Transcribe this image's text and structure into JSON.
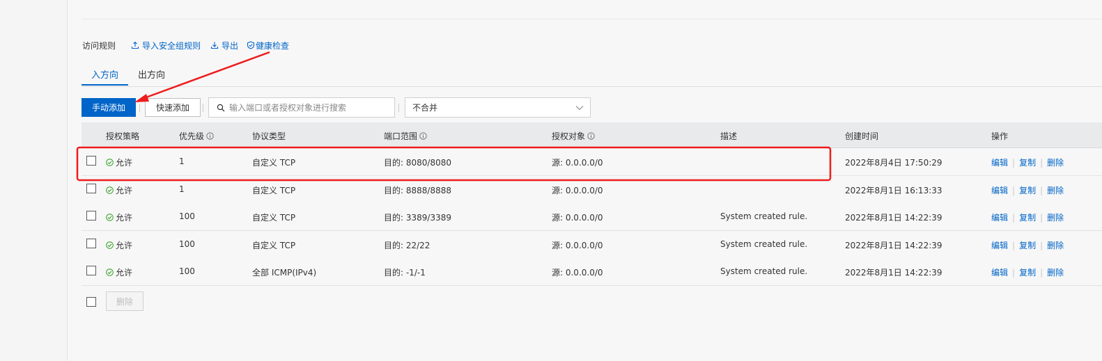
{
  "section": {
    "title": "访问规则",
    "links": {
      "import": "导入安全组规则",
      "export": "导出",
      "health": "健康检查"
    }
  },
  "tabs": [
    "入方向",
    "出方向"
  ],
  "toolbar": {
    "manual_add": "手动添加",
    "quick_add": "快速添加",
    "search_placeholder": "输入端口或者授权对象进行搜索",
    "merge_select": "不合并"
  },
  "table": {
    "columns": [
      "授权策略",
      "优先级",
      "协议类型",
      "端口范围",
      "授权对象",
      "描述",
      "创建时间",
      "操作"
    ],
    "rows": [
      {
        "policy": "允许",
        "priority": "1",
        "protocol": "自定义 TCP",
        "port": "目的: 8080/8080",
        "source": "源: 0.0.0.0/0",
        "desc": "",
        "created": "2022年8月4日 17:50:29"
      },
      {
        "policy": "允许",
        "priority": "1",
        "protocol": "自定义 TCP",
        "port": "目的: 8888/8888",
        "source": "源: 0.0.0.0/0",
        "desc": "",
        "created": "2022年8月1日 16:13:33"
      },
      {
        "policy": "允许",
        "priority": "100",
        "protocol": "自定义 TCP",
        "port": "目的: 3389/3389",
        "source": "源: 0.0.0.0/0",
        "desc": "System created rule.",
        "created": "2022年8月1日 14:22:39"
      },
      {
        "policy": "允许",
        "priority": "100",
        "protocol": "自定义 TCP",
        "port": "目的: 22/22",
        "source": "源: 0.0.0.0/0",
        "desc": "System created rule.",
        "created": "2022年8月1日 14:22:39"
      },
      {
        "policy": "允许",
        "priority": "100",
        "protocol": "全部 ICMP(IPv4)",
        "port": "目的: -1/-1",
        "source": "源: 0.0.0.0/0",
        "desc": "System created rule.",
        "created": "2022年8月1日 14:22:39"
      }
    ],
    "actions": {
      "edit": "编辑",
      "copy": "复制",
      "delete": "删除"
    }
  },
  "footer": {
    "delete_button": "删除"
  },
  "icons": {
    "import": "upload-icon",
    "export": "download-icon",
    "health": "shield-check-icon",
    "search": "search-icon",
    "select": "chevron-down-icon",
    "info": "info-circle-icon",
    "allow": "check-circle-icon"
  },
  "colors": {
    "accent": "#0064c8",
    "allow": "#2ea121",
    "annotation": "#ee1c1c"
  }
}
